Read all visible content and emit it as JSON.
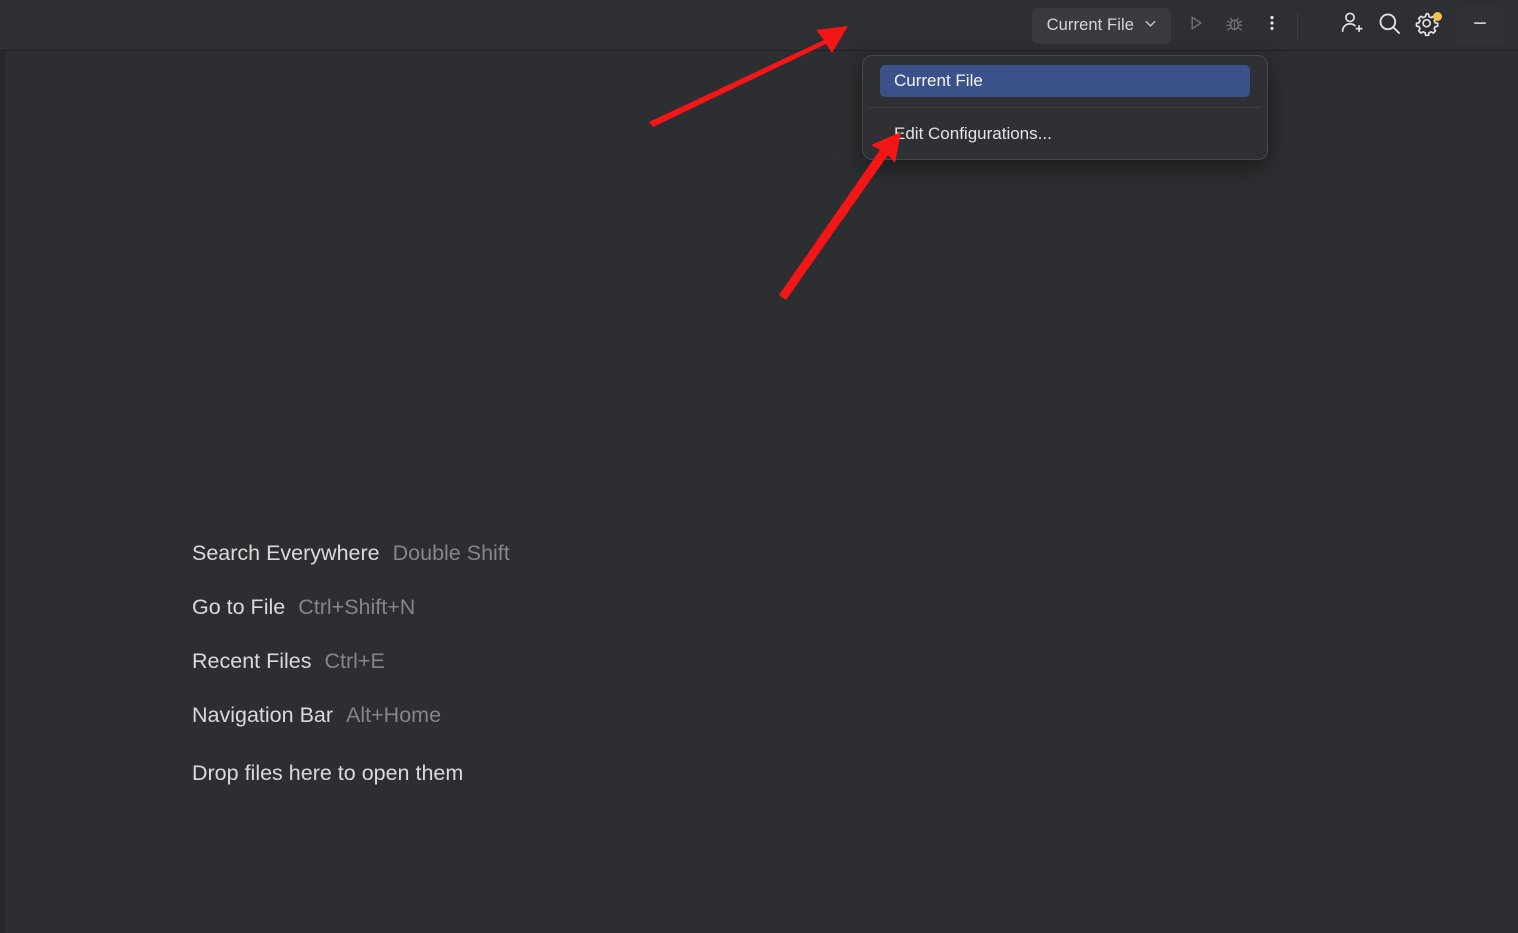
{
  "window": {
    "background_color": "#2d2e31",
    "titlebar_color": "#2e2f32"
  },
  "titlebar": {
    "run_config": {
      "label": "Current File",
      "chevron_icon": "chevron-down-icon",
      "background_color": "#393b3f"
    },
    "actions": [
      {
        "name": "run-button",
        "icon": "play-icon",
        "enabled": false
      },
      {
        "name": "debug-button",
        "icon": "bug-icon",
        "enabled": false
      },
      {
        "name": "more-actions-button",
        "icon": "more-vertical-icon",
        "enabled": true
      }
    ],
    "right_actions": [
      {
        "name": "add-user-button",
        "icon": "user-plus-icon"
      },
      {
        "name": "search-button",
        "icon": "search-icon"
      },
      {
        "name": "settings-button",
        "icon": "gear-icon",
        "badge": true,
        "badge_color": "#f2c14e"
      }
    ],
    "window_controls": [
      {
        "name": "minimize-button",
        "icon": "minimize-icon",
        "label": "—"
      }
    ]
  },
  "run_config_popup": {
    "visible": true,
    "selected_index": 0,
    "highlight_color": "#3a5189",
    "border_color": "#46484d",
    "items": [
      {
        "label": "Current File",
        "selected": true
      },
      {
        "label": "Edit Configurations...",
        "selected": false
      }
    ]
  },
  "editor_hints": {
    "rows": [
      {
        "action": "Search Everywhere",
        "shortcut": "Double Shift"
      },
      {
        "action": "Go to File",
        "shortcut": "Ctrl+Shift+N"
      },
      {
        "action": "Recent Files",
        "shortcut": "Ctrl+E"
      },
      {
        "action": "Navigation Bar",
        "shortcut": "Alt+Home"
      }
    ],
    "drop_hint": "Drop files here to open them"
  },
  "annotations": {
    "color": "#f41616",
    "arrows": [
      {
        "name": "arrow-to-run-config-chip",
        "target": "Current File chip"
      },
      {
        "name": "arrow-to-edit-configurations",
        "target": "Edit Configurations..."
      }
    ]
  }
}
